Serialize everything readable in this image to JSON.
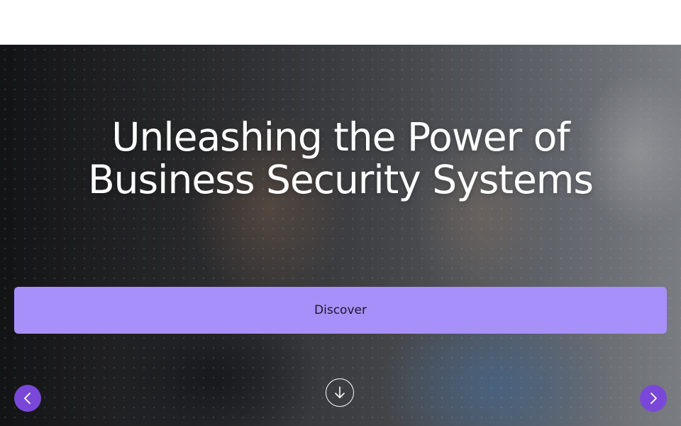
{
  "hero": {
    "title": "Unleashing the Power of Business Security Systems",
    "cta_label": "Discover"
  },
  "icons": {
    "prev": "chevron-left-icon",
    "next": "chevron-right-icon",
    "scroll": "arrow-down-icon"
  },
  "colors": {
    "cta_background": "#a890fa",
    "cta_text": "#1b1430",
    "arrow_background": "#7a48d8",
    "title_text": "#ffffff"
  }
}
